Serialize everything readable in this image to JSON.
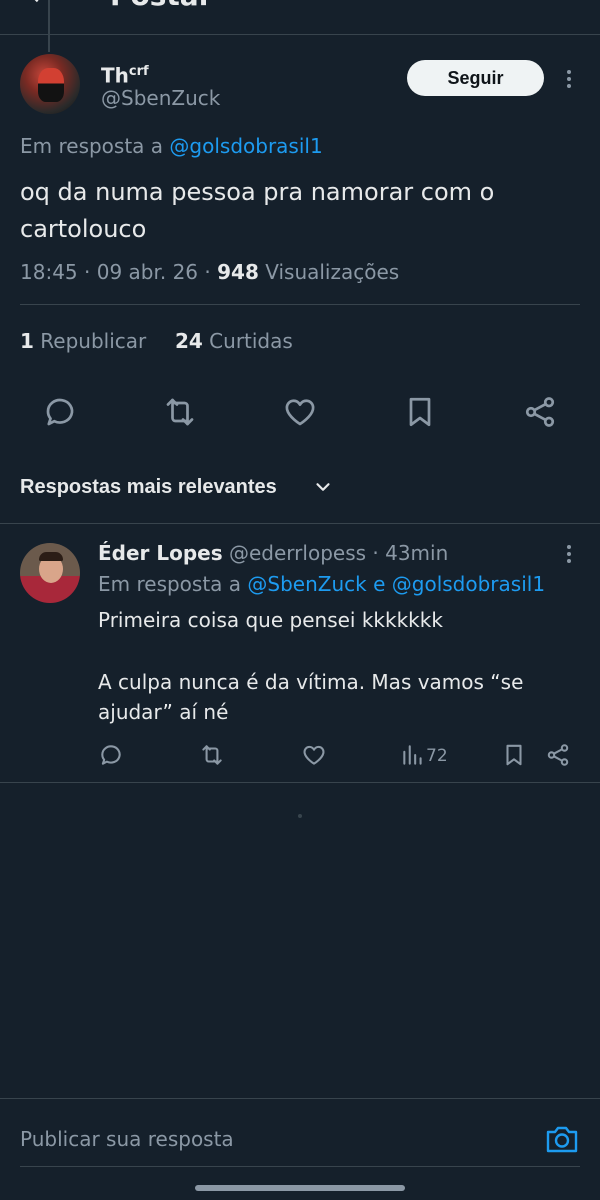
{
  "header": {
    "title": "Postar"
  },
  "post": {
    "author_name": "Th",
    "author_name_sup": "crf",
    "author_handle": "@SbenZuck",
    "follow_label": "Seguir",
    "reply_prefix": "Em resposta a",
    "reply_to_handle": "@golsdobrasil1",
    "text_line1": "oq da numa pessoa pra namorar com o",
    "text_line2": "cartolouco",
    "time": "18:45",
    "date": "09 abr. 26",
    "views_count": "948",
    "views_label": "Visualizações",
    "reposts_count": "1",
    "reposts_label": "Republicar",
    "likes_count": "24",
    "likes_label": "Curtidas"
  },
  "replies_section": {
    "label": "Respostas mais relevantes"
  },
  "reply": {
    "author_name": "Éder Lopes",
    "author_handle": "@ederrlopess",
    "time_ago": "43min",
    "reply_prefix": "Em resposta a",
    "reply_to_handle_1": "@SbenZuck",
    "reply_conj": "e",
    "reply_to_handle_2": "@golsdobrasil1",
    "text_p1": "Primeira coisa que pensei kkkkkkk",
    "text_p2": "A culpa nunca é da vítima. Mas vamos “se ajudar” aí né",
    "views": "72"
  },
  "composer": {
    "placeholder": "Publicar sua resposta"
  },
  "colors": {
    "background": "#15202b",
    "accent": "#1d9bf0",
    "muted": "#8b98a5",
    "text": "#e7e9ea"
  },
  "icons": [
    "back-arrow-icon",
    "more-icon",
    "reply-icon",
    "repost-icon",
    "like-icon",
    "bookmark-icon",
    "share-icon",
    "chevron-down-icon",
    "views-icon",
    "camera-icon"
  ]
}
